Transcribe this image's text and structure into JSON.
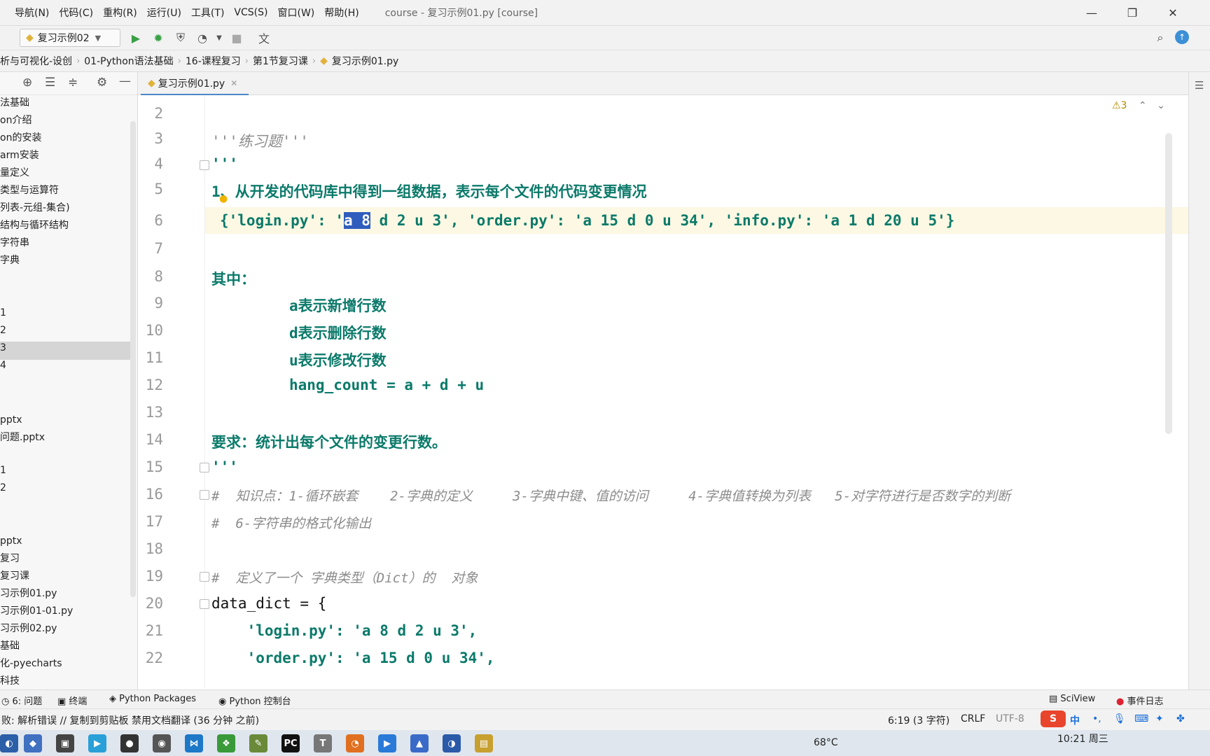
{
  "menu": {
    "items": [
      "导航(N)",
      "代码(C)",
      "重构(R)",
      "运行(U)",
      "工具(T)",
      "VCS(S)",
      "窗口(W)",
      "帮助(H)"
    ],
    "title": "course - 复习示例01.py [course]"
  },
  "toolbar": {
    "run_config": "复习示例02"
  },
  "breadcrumb": [
    "析与可视化-设创",
    "01-Python语法基础",
    "16-课程复习",
    "第1节复习课",
    "复习示例01.py"
  ],
  "project_tree": [
    "法基础",
    "on介绍",
    "on的安装",
    "arm安装",
    "量定义",
    "类型与运算符",
    "列表-元组-集合)",
    "结构与循环结构",
    "字符串",
    "字典",
    "1",
    "2",
    "3",
    "4",
    "pptx",
    "问题.pptx",
    "1",
    "2",
    "pptx",
    "复习",
    "复习课",
    "习示例01.py",
    "习示例01-01.py",
    "习示例02.py",
    "基础",
    "化-pyecharts",
    "科技"
  ],
  "editor": {
    "tab_label": "复习示例01.py",
    "warnings": "⚠3",
    "line_numbers": [
      "2",
      "3",
      "4",
      "5",
      "6",
      "7",
      "8",
      "9",
      "10",
      "11",
      "12",
      "13",
      "14",
      "15",
      "16",
      "17",
      "18",
      "19",
      "20",
      "21",
      "22"
    ],
    "lines": {
      "l3": "'''练习题'''",
      "l4": "'''",
      "l5": "1、从开发的代码库中得到一组数据，表示每个文件的代码变更情况",
      "l6_pre": "{'login.py': '",
      "l6_sel": "a 8",
      "l6_post": " d 2 u 3', 'order.py': 'a 15 d 0 u 34', 'info.py': 'a 1 d 20 u 5'}",
      "l8": "其中：",
      "l9": "a表示新增行数",
      "l10": "d表示删除行数",
      "l11": "u表示修改行数",
      "l12": "hang_count = a + d + u",
      "l14": "要求：统计出每个文件的变更行数。",
      "l15": "'''",
      "l16": "#  知识点：1-循环嵌套    2-字典的定义     3-字典中键、值的访问     4-字典值转换为列表   5-对字符进行是否数字的判断",
      "l17": "#  6-字符串的格式化输出",
      "l19": "#  定义了一个 字典类型（Dict）的  对象",
      "l20": "data_dict = {",
      "l21": "    'login.py': 'a 8 d 2 u 3',",
      "l22": "    'order.py': 'a 15 d 0 u 34',"
    }
  },
  "tool_windows": [
    "6: 问题",
    "终端",
    "Python Packages",
    "Python 控制台",
    "SciView",
    "事件日志"
  ],
  "status": {
    "message": "败: 解析错误 // 复制到剪贴板  禁用文档翻译 (36 分钟 之前)",
    "position": "6:19 (3 字符)",
    "line_sep": "CRLF",
    "encoding": "UTF-8"
  },
  "taskbar": {
    "temperature": "68°C",
    "time": "10:21 周三",
    "ime": "中"
  },
  "colors": {
    "accent": "#4a88c7",
    "string": "#0b7a6a",
    "comment": "#8c8c8c",
    "selection": "#2f5dbd"
  }
}
